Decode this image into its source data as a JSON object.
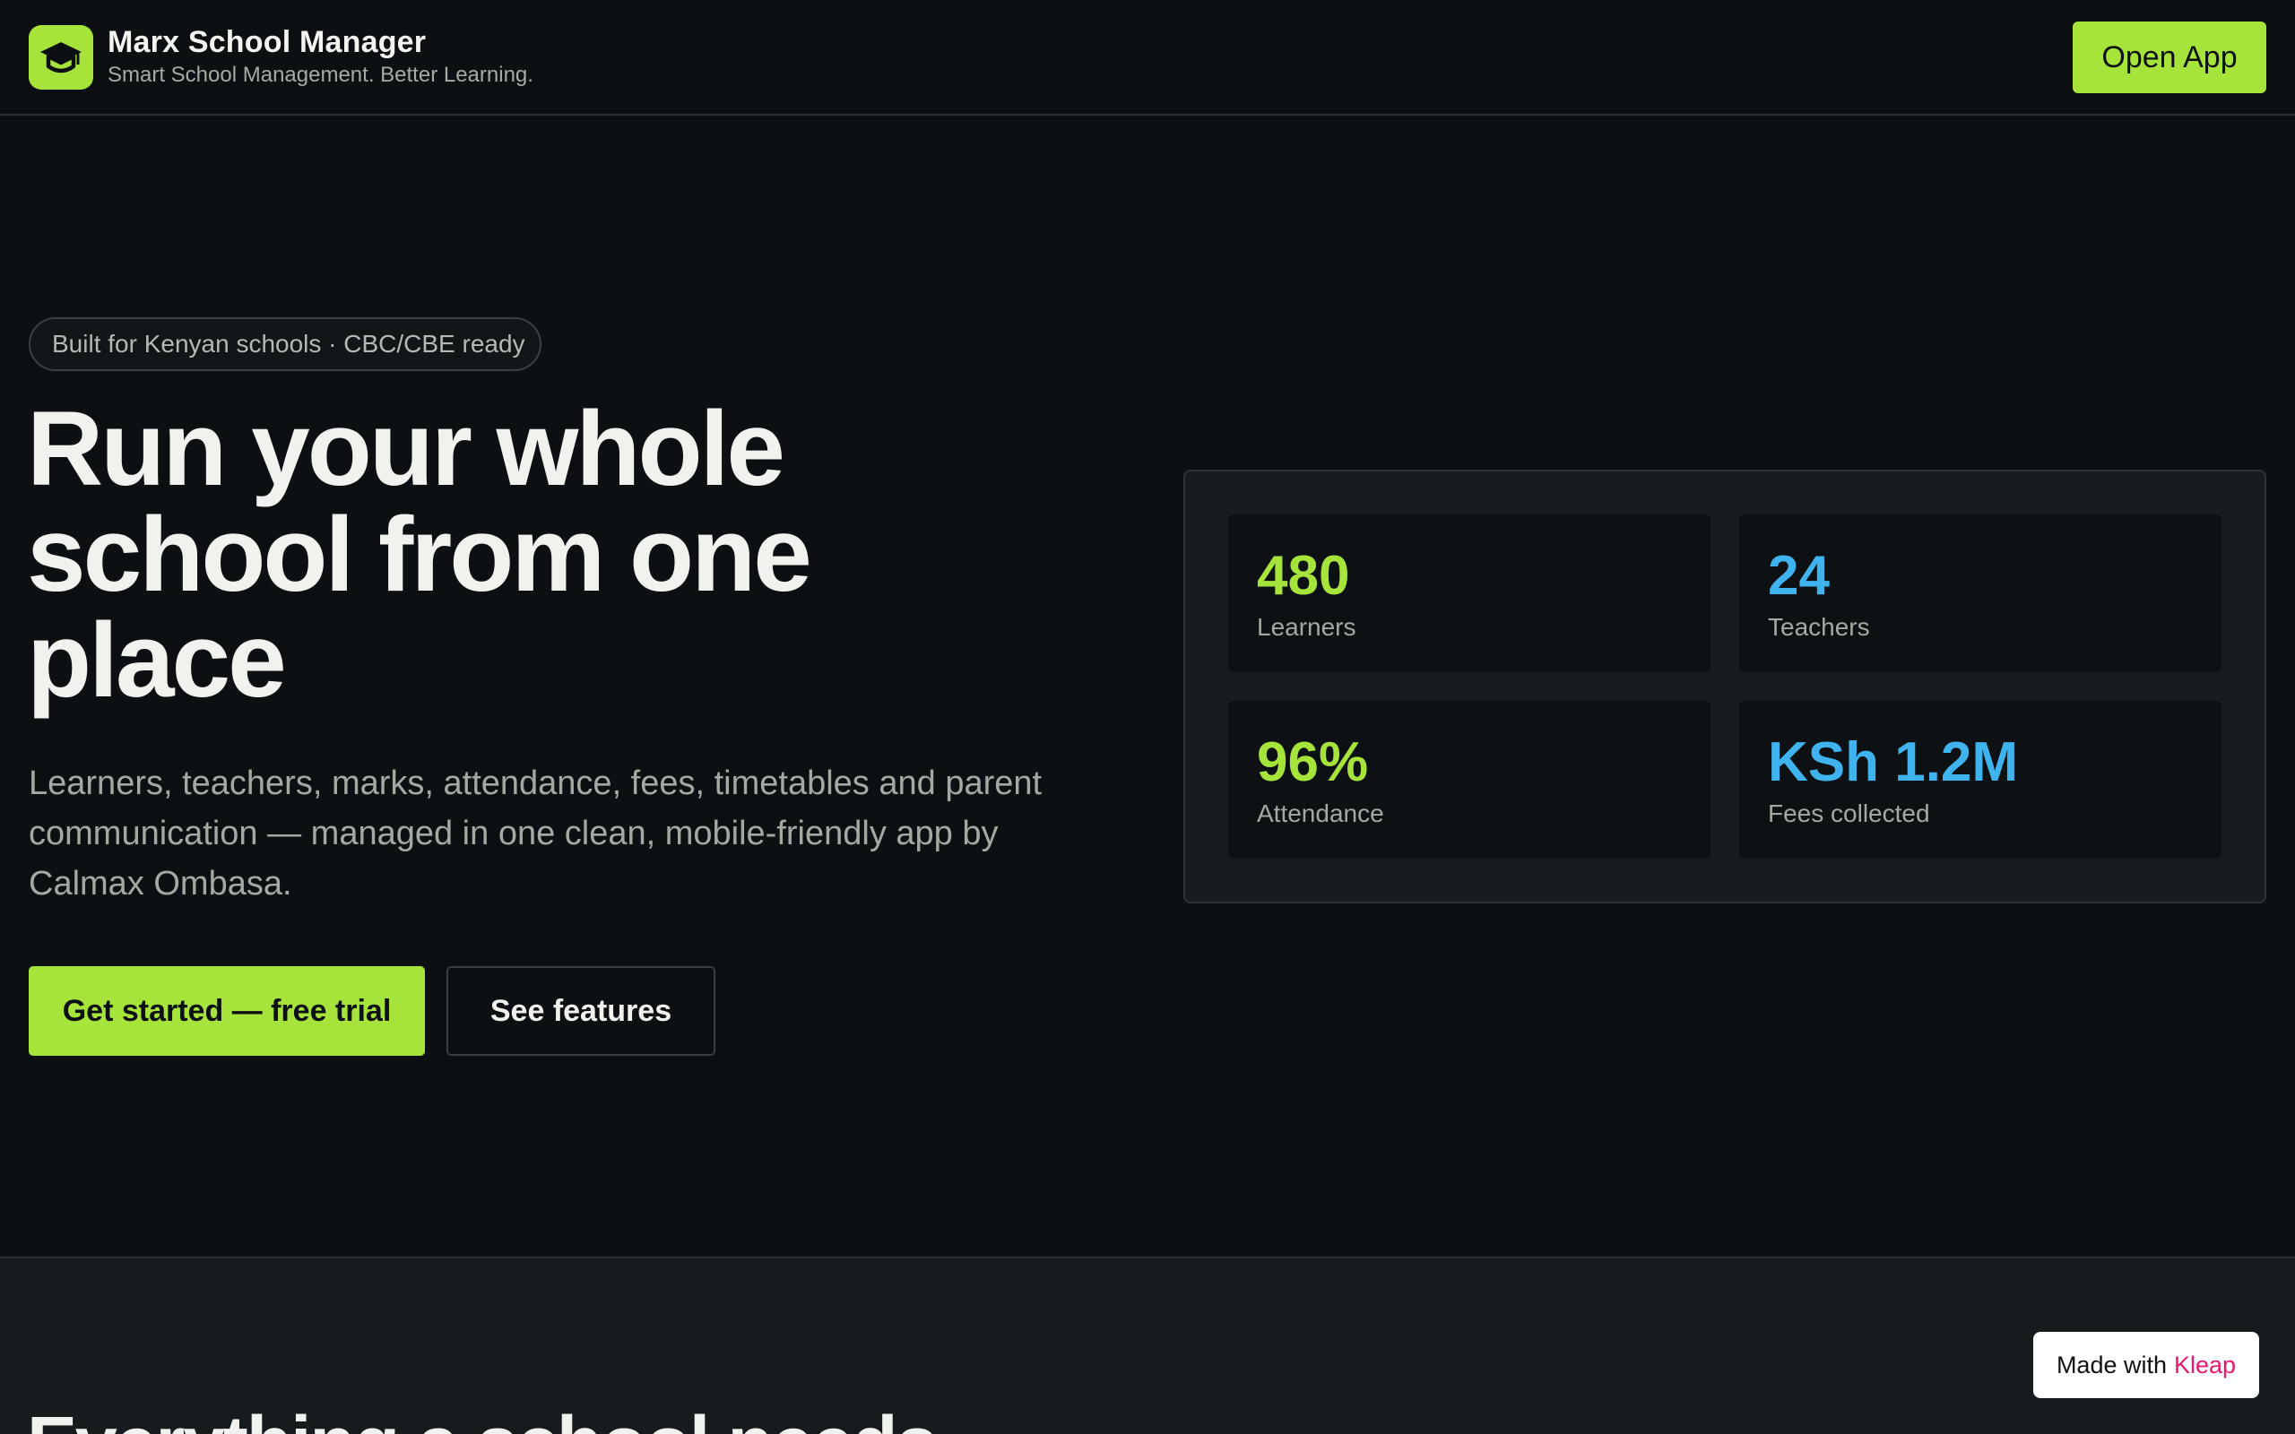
{
  "header": {
    "brand_name": "Marx School Manager",
    "brand_tagline": "Smart School Management. Better Learning.",
    "logo_icon": "graduation-cap-icon",
    "open_app_label": "Open App"
  },
  "hero": {
    "pill_text": "Built for Kenyan schools · CBC/CBE ready",
    "title_lines": [
      "Run your whole",
      "school from one",
      "place"
    ],
    "description": "Learners, teachers, marks, attendance, fees, timetables and parent communication — managed in one clean, mobile-friendly app by Calmax Ombasa.",
    "primary_cta": "Get started — free trial",
    "secondary_cta": "See features"
  },
  "stats": [
    {
      "value": "480",
      "label": "Learners",
      "color": "#a6e43b"
    },
    {
      "value": "24",
      "label": "Teachers",
      "color": "#3fb3ee"
    },
    {
      "value": "96%",
      "label": "Attendance",
      "color": "#a6e43b"
    },
    {
      "value": "KSh 1.2M",
      "label": "Fees collected",
      "color": "#3fb3ee"
    }
  ],
  "features_section": {
    "title": "Everything a school needs"
  },
  "badge": {
    "prefix": "Made with",
    "brand": "Kleap"
  },
  "colors": {
    "accent_green": "#a6e43b",
    "accent_blue": "#3fb3ee",
    "background": "#0d1012",
    "kleap_pink": "#e8186e"
  }
}
